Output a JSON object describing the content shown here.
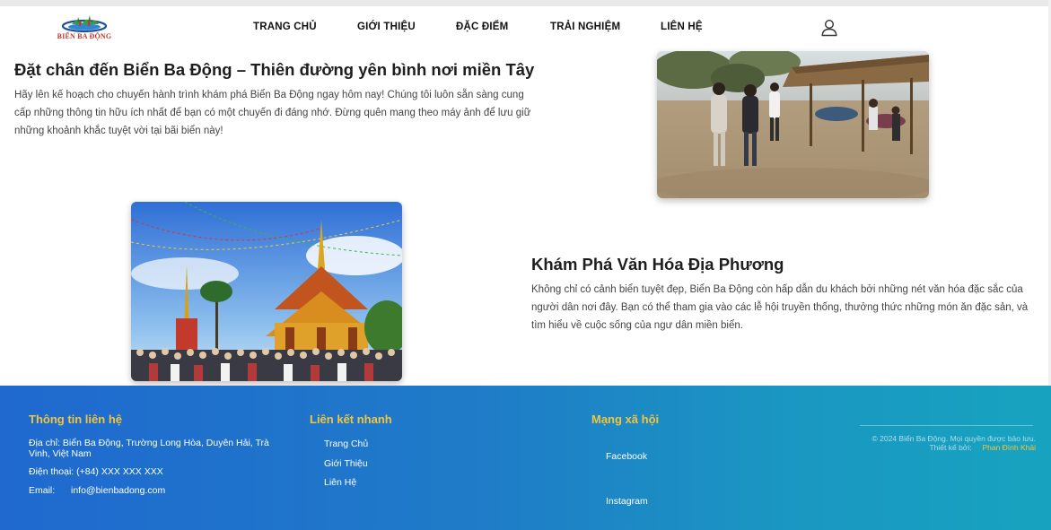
{
  "brand": {
    "logo_text": "BIỂN BA ĐỘNG"
  },
  "nav": {
    "items": [
      "TRANG CHỦ",
      "GIỚI THIỆU",
      "ĐẶC ĐIỂM",
      "TRẢI NGHIỆM",
      "LIÊN HỆ"
    ]
  },
  "intro": {
    "title": "Đặt chân đến Biển Ba Động – Thiên đường yên bình nơi miền Tây",
    "text": "Hãy lên kế hoạch cho chuyến hành trình khám phá Biển Ba Động ngay hôm nay! Chúng tôi luôn sẵn sàng cung cấp những thông tin hữu ích nhất để bạn có một chuyến đi đáng nhớ. Đừng quên mang theo máy ảnh để lưu giữ những khoảnh khắc tuyệt vời tại bãi biển này!"
  },
  "culture": {
    "title": "Khám Phá Văn Hóa Địa Phương",
    "text": "Không chỉ có cảnh biển tuyệt đẹp, Biển Ba Động còn hấp dẫn du khách bởi những nét văn hóa đặc sắc của người dân nơi đây. Bạn có thể tham gia vào các lễ hội truyền thống, thưởng thức những món ăn đặc sản, và tìm hiểu về cuộc sống của ngư dân miền biển."
  },
  "footer": {
    "contact": {
      "heading": "Thông tin liên hệ",
      "address": "Địa chỉ: Biển Ba Động, Trường Long Hòa, Duyên Hải, Trà Vinh, Việt Nam",
      "phone": "Điện thoại: (+84) XXX XXX XXX",
      "email_label": "Email:",
      "email": "info@bienbadong.com"
    },
    "quick_links": {
      "heading": "Liên kết nhanh",
      "items": [
        "Trang Chủ",
        "Giới Thiệu",
        "Liên Hệ"
      ]
    },
    "social": {
      "heading": "Mạng xã hội",
      "items": [
        "Facebook",
        "Instagram"
      ]
    },
    "copyright": "© 2024 Biển Ba Động. Mọi quyền được bảo lưu.",
    "designer_label": "Thiết kế bởi:",
    "designer": "Phan Đình Khải"
  },
  "colors": {
    "footer_heading": "#f2c53d",
    "footer_start": "#1f69cf",
    "footer_end": "#17a3bf"
  },
  "icons": {
    "user": "user-icon",
    "logo": "logo-icon"
  }
}
